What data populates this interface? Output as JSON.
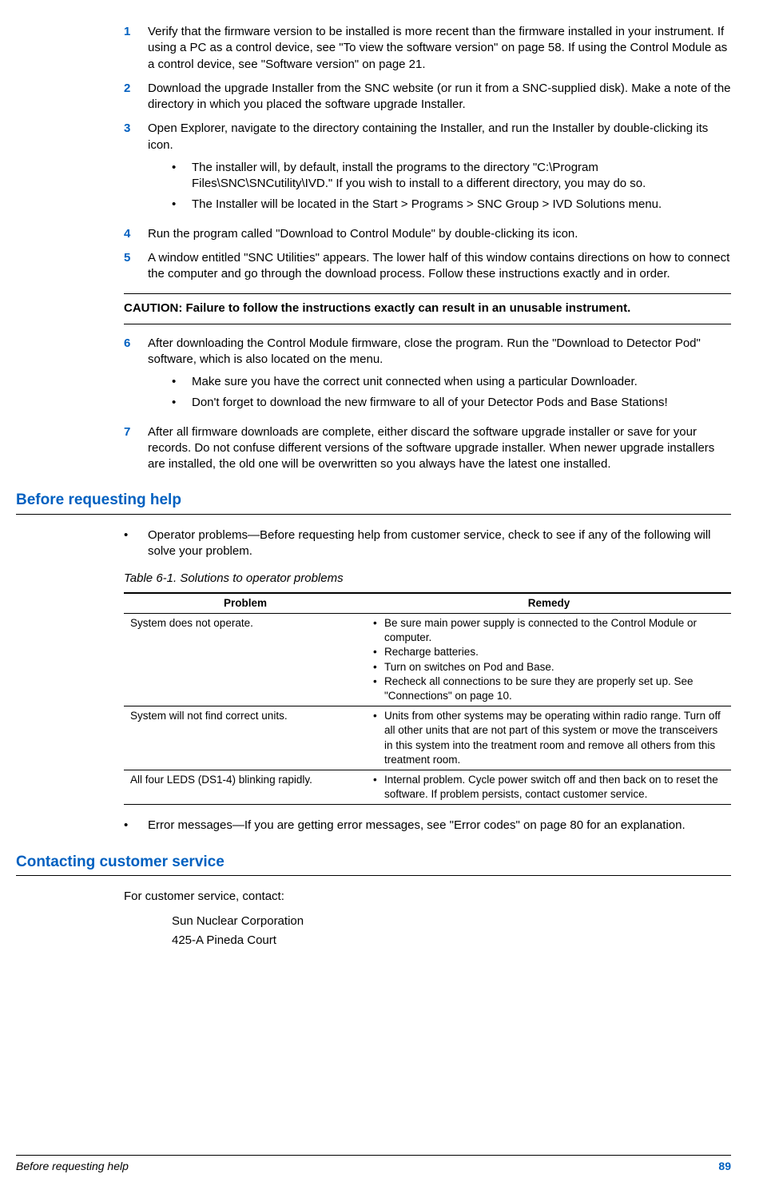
{
  "steps": {
    "s1": {
      "num": "1",
      "text": "Verify that the firmware version to be installed is more recent than the firmware installed in your instrument. If using a PC as a control device, see \"To view the software version\" on page 58. If using the Control Module as a control device, see \"Software version\" on page 21."
    },
    "s2": {
      "num": "2",
      "text": "Download the upgrade Installer from the SNC website (or run it from a SNC-supplied disk). Make a note of the directory in which you placed the software upgrade Installer."
    },
    "s3": {
      "num": "3",
      "text": "Open Explorer, navigate to the directory containing the Installer, and run the Installer by double-clicking its icon.",
      "subs": [
        "The installer will, by default, install the programs to the directory \"C:\\Program Files\\SNC\\SNCutility\\IVD.\" If you wish to install to a different directory, you may do so.",
        "The Installer will be located in the Start > Programs > SNC Group > IVD Solutions menu."
      ]
    },
    "s4": {
      "num": "4",
      "text": "Run the program called \"Download to Control Module\" by double-clicking its icon."
    },
    "s5": {
      "num": "5",
      "text": "A window entitled \"SNC Utilities\" appears. The lower half of this window contains directions on how to connect the computer and go through the download process. Follow these instructions exactly and in order."
    },
    "s6": {
      "num": "6",
      "text": "After downloading the Control Module firmware, close the program. Run the \"Download to Detector Pod\" software, which is also located on the menu.",
      "subs": [
        "Make sure you have the correct unit connected when using a particular Downloader.",
        "Don't forget to download the new firmware to all of your Detector Pods and Base Stations!"
      ]
    },
    "s7": {
      "num": "7",
      "text": "After all firmware downloads are complete, either discard the software upgrade installer or save for your records. Do not confuse different versions of the software upgrade installer. When newer upgrade installers are installed, the old one will be overwritten so you always have the latest one installed."
    }
  },
  "caution": "CAUTION: Failure to follow the instructions exactly can result in an unusable instrument.",
  "section1": {
    "heading": "Before requesting help",
    "bullet1": "Operator problems—Before requesting help from customer service, check to see if any of the following will solve your problem.",
    "tableCaption": "Table 6-1. Solutions to operator problems",
    "th1": "Problem",
    "th2": "Remedy",
    "rows": [
      {
        "problem": "System does not operate.",
        "remedies": [
          "Be sure main power supply is connected to the Control Module or computer.",
          "Recharge batteries.",
          "Turn on switches on Pod and Base.",
          "Recheck all connections to be sure they are properly set up. See \"Connections\" on page 10."
        ]
      },
      {
        "problem": "System will not find correct units.",
        "remedies": [
          "Units from other systems may be operating within radio range. Turn off all other units that are not part of this system or move the transceivers in this system into the treatment room and remove all others from this treatment room."
        ]
      },
      {
        "problem": "All four LEDS (DS1-4) blinking rapidly.",
        "remedies": [
          "Internal problem. Cycle power switch off and then back on to reset the software. If problem persists, contact customer service."
        ]
      }
    ],
    "bullet2": "Error messages—If you are getting error messages, see \"Error codes\" on page 80 for an explanation."
  },
  "section2": {
    "heading": "Contacting customer service",
    "intro": "For customer service, contact:",
    "lines": [
      "Sun Nuclear Corporation",
      "425-A Pineda Court"
    ]
  },
  "footer": {
    "left": "Before requesting help",
    "page": "89"
  }
}
